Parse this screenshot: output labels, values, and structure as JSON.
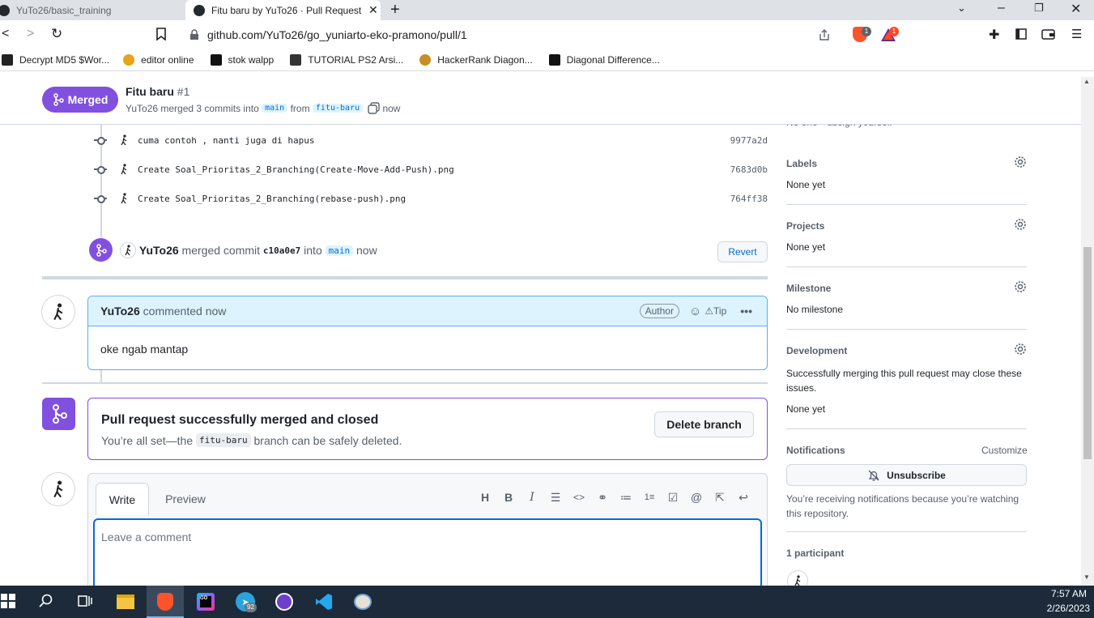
{
  "browser": {
    "tabs": [
      {
        "title": "YuTo26/basic_training",
        "active": false
      },
      {
        "title": "Fitu baru by YuTo26 · Pull Request",
        "active": true
      }
    ],
    "url": "github.com/YuTo26/go_yuniarto-eko-pramono/pull/1",
    "brave_badge": "1",
    "alert_badge": "1",
    "bookmarks": [
      {
        "label": "Decrypt MD5 $Wor...",
        "icon": "bookmark-icon"
      },
      {
        "label": "editor online",
        "icon": "bookmark-icon"
      },
      {
        "label": "stok walpp",
        "icon": "bookmark-icon"
      },
      {
        "label": "TUTORIAL PS2 Arsi...",
        "icon": "bookmark-icon"
      },
      {
        "label": "HackerRank Diagon...",
        "icon": "bookmark-icon"
      },
      {
        "label": "Diagonal Difference...",
        "icon": "bookmark-icon"
      }
    ]
  },
  "pr_header": {
    "state": "Merged",
    "title": "Fitu baru",
    "number": "#1",
    "author": "YuTo26",
    "merged_text": "merged 3 commits into",
    "base_branch": "main",
    "from_text": "from",
    "head_branch": "fitu-baru",
    "time": "now"
  },
  "commits": [
    {
      "message": "cuma contoh , nanti juga di hapus",
      "sha": "9977a2d"
    },
    {
      "message": "Create Soal_Prioritas_2_Branching(Create-Move-Add-Push).png",
      "sha": "7683d0b"
    },
    {
      "message": "Create Soal_Prioritas_2_Branching(rebase-push).png",
      "sha": "764ff38"
    }
  ],
  "merge_event": {
    "user": "YuTo26",
    "text": "merged commit",
    "commit": "c10a0e7",
    "into": "into",
    "branch": "main",
    "time": "now",
    "revert_label": "Revert"
  },
  "comment": {
    "user": "YuTo26",
    "action": "commented now",
    "badge": "Author",
    "tip": "Tip",
    "body": "oke ngab mantap"
  },
  "merged_status": {
    "title": "Pull request successfully merged and closed",
    "text_before": "You’re all set—the",
    "branch": "fitu-baru",
    "text_after": "branch can be safely deleted.",
    "delete_label": "Delete branch"
  },
  "editor": {
    "write_tab": "Write",
    "preview_tab": "Preview",
    "placeholder": "Leave a comment"
  },
  "sidebar": {
    "assignees_partial": "No one—assign yourself",
    "labels": {
      "title": "Labels",
      "value": "None yet"
    },
    "projects": {
      "title": "Projects",
      "value": "None yet"
    },
    "milestone": {
      "title": "Milestone",
      "value": "No milestone"
    },
    "development": {
      "title": "Development",
      "desc": "Successfully merging this pull request may close these issues.",
      "value": "None yet"
    },
    "notifications": {
      "title": "Notifications",
      "customize": "Customize",
      "unsubscribe": "Unsubscribe",
      "desc": "You’re receiving notifications because you’re watching this repository."
    },
    "participants": {
      "title": "1 participant"
    }
  },
  "taskbar": {
    "time": "7:57 AM",
    "date": "2/26/2023",
    "telegram_badge": "92"
  },
  "colors": {
    "merged": "#8250df",
    "link": "#0969da",
    "accent_blue": "#54aeff",
    "taskbar": "#1c2a3a"
  }
}
